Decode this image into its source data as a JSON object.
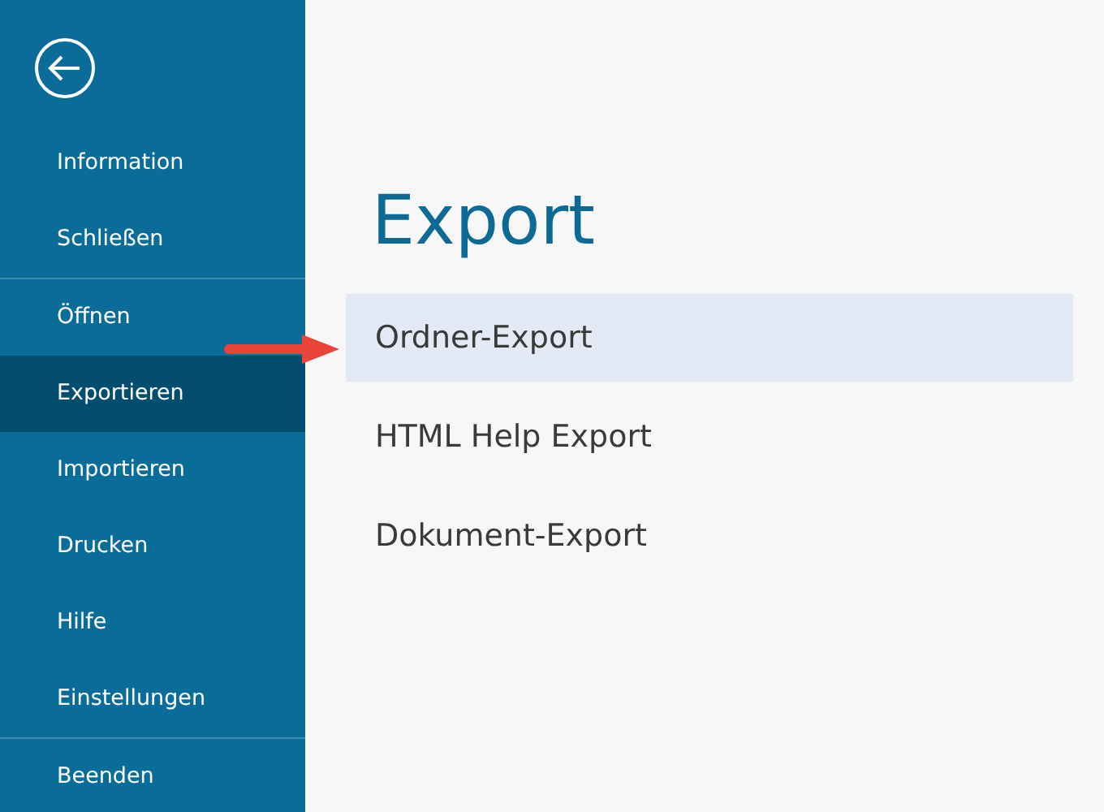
{
  "sidebar": {
    "groups": [
      {
        "items": [
          {
            "label": "Information",
            "selected": false
          },
          {
            "label": "Schließen",
            "selected": false
          }
        ]
      },
      {
        "items": [
          {
            "label": "Öffnen",
            "selected": false
          },
          {
            "label": "Exportieren",
            "selected": true
          },
          {
            "label": "Importieren",
            "selected": false
          },
          {
            "label": "Drucken",
            "selected": false
          },
          {
            "label": "Hilfe",
            "selected": false
          },
          {
            "label": "Einstellungen",
            "selected": false
          }
        ]
      },
      {
        "items": [
          {
            "label": "Beenden",
            "selected": false
          }
        ]
      }
    ]
  },
  "main": {
    "title": "Export",
    "options": [
      {
        "label": "Ordner-Export",
        "selected": true
      },
      {
        "label": "HTML Help Export",
        "selected": false
      },
      {
        "label": "Dokument-Export",
        "selected": false
      }
    ]
  }
}
